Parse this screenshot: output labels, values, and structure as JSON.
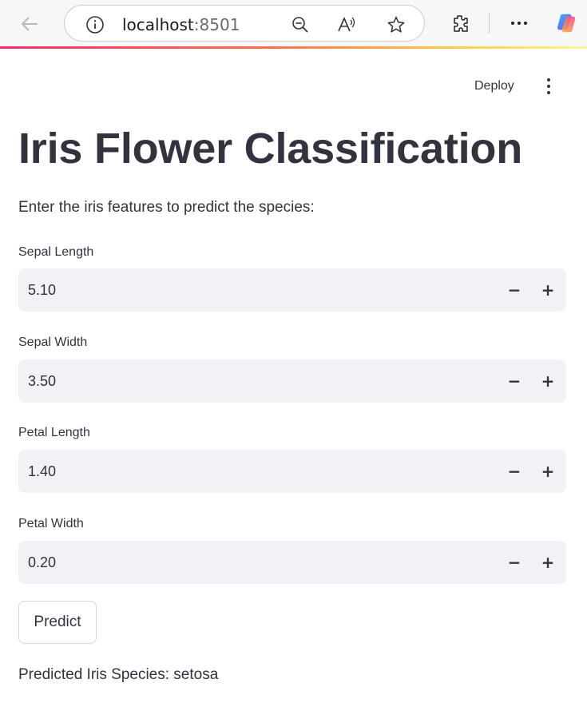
{
  "browser": {
    "url_host": "localhost",
    "url_port": ":8501"
  },
  "header": {
    "deploy_label": "Deploy"
  },
  "main": {
    "title": "Iris Flower Classification",
    "subtitle": "Enter the iris features to predict the species:",
    "fields": [
      {
        "label": "Sepal Length",
        "value": "5.10"
      },
      {
        "label": "Sepal Width",
        "value": "3.50"
      },
      {
        "label": "Petal Length",
        "value": "1.40"
      },
      {
        "label": "Petal Width",
        "value": "0.20"
      }
    ],
    "stepper_minus": "−",
    "stepper_plus": "+",
    "predict_label": "Predict",
    "result": "Predicted Iris Species: setosa"
  },
  "colors": {
    "input_bg": "#f0f2f6",
    "text": "#31333f",
    "accent_start": "#ff2b6b",
    "accent_end": "#fff59a"
  }
}
